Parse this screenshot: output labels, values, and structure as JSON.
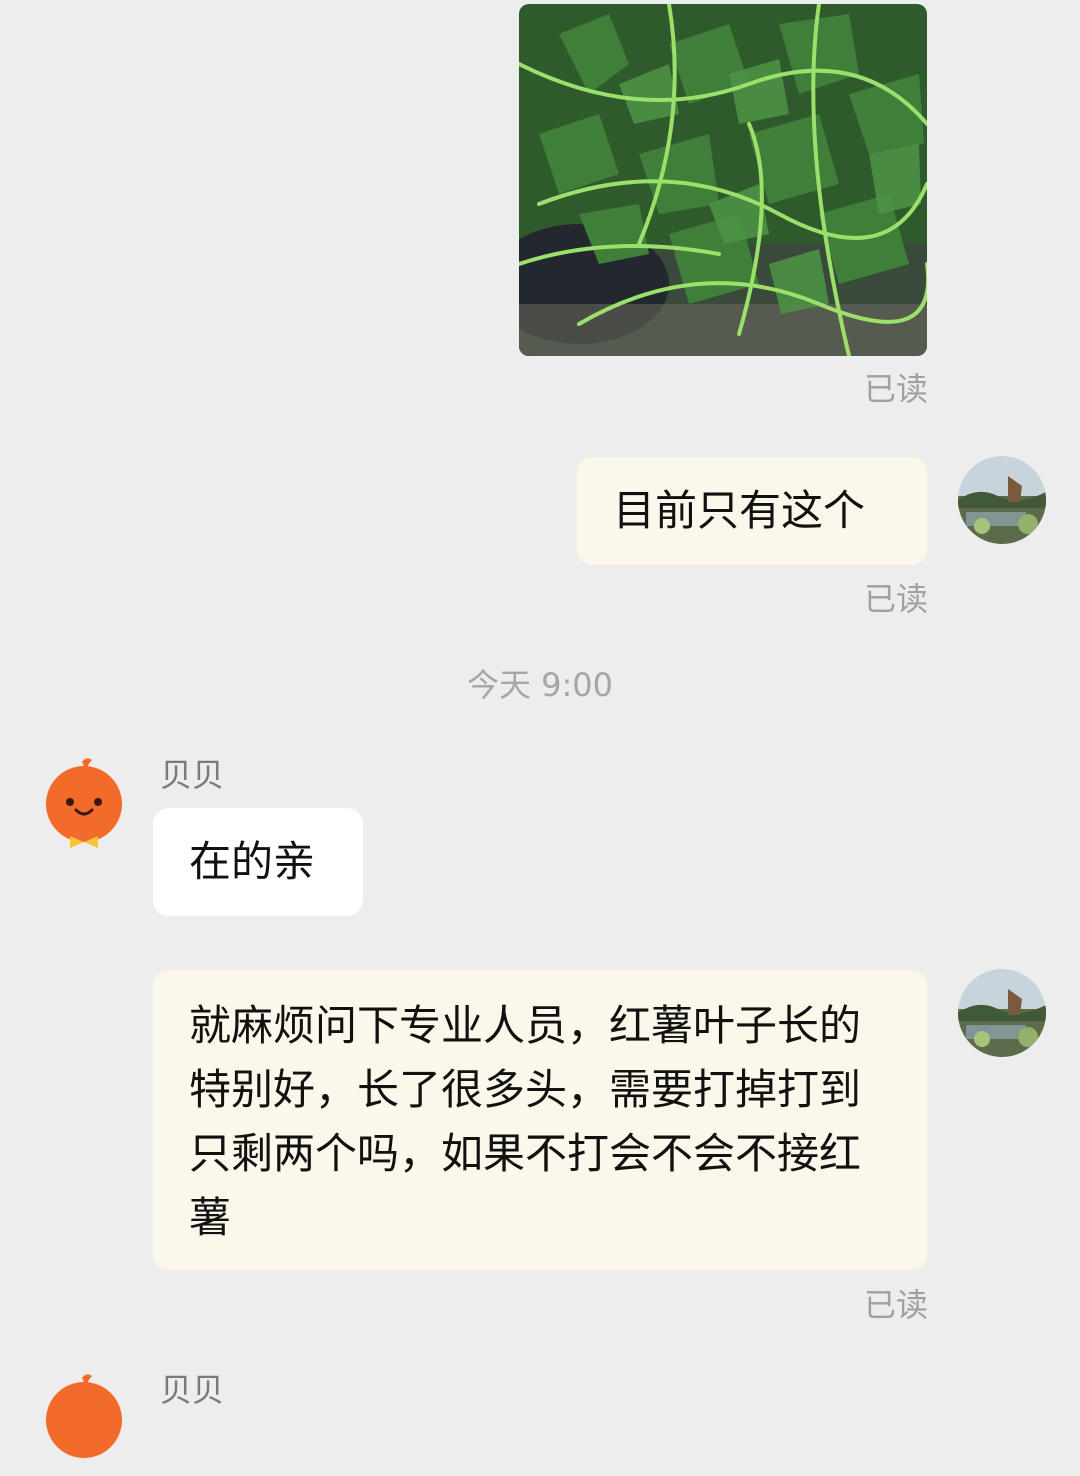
{
  "messages": {
    "photo_read": "已读",
    "msg1": {
      "text": "目前只有这个",
      "status": "已读"
    },
    "timestamp": "今天 9:00",
    "sender_name": "贝贝",
    "msg2": {
      "text": "在的亲"
    },
    "msg3": {
      "text": "就麻烦问下专业人员，红薯叶子长的特别好，长了很多头，需要打掉打到只剩两个吗，如果不打会不会不接红薯",
      "status": "已读"
    },
    "next_sender_name": "贝贝"
  },
  "colors": {
    "background": "#ededed",
    "my_bubble": "#fbf7ea",
    "their_bubble": "#ffffff",
    "read_receipt": "#a0a0a0",
    "mascot_orange": "#f26b2a"
  },
  "icons": {
    "my_avatar": "garden-photo-avatar",
    "their_avatar": "orange-mascot-avatar"
  }
}
